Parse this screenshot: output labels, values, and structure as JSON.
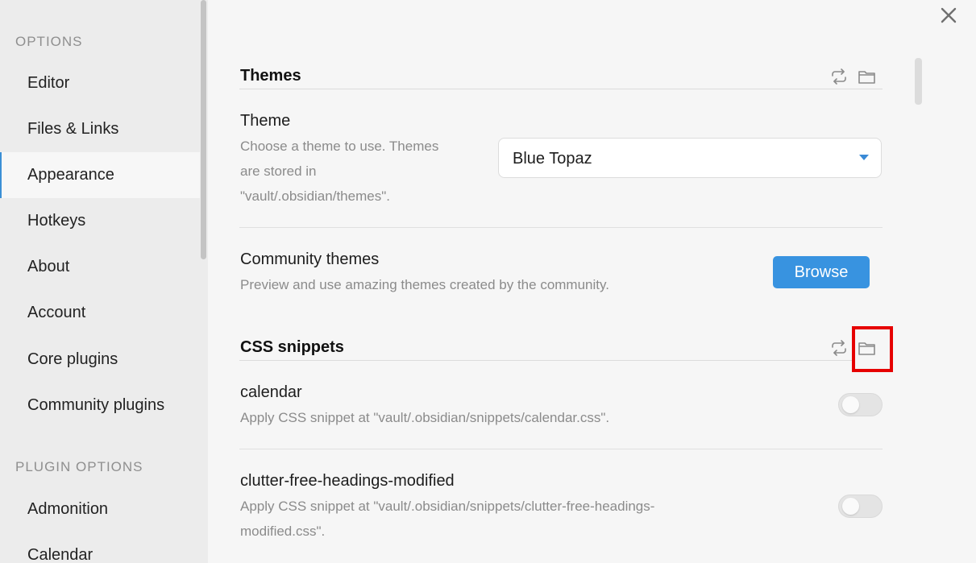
{
  "sidebar": {
    "section_options": "OPTIONS",
    "items": [
      {
        "label": "Editor"
      },
      {
        "label": "Files & Links"
      },
      {
        "label": "Appearance"
      },
      {
        "label": "Hotkeys"
      },
      {
        "label": "About"
      },
      {
        "label": "Account"
      },
      {
        "label": "Core plugins"
      },
      {
        "label": "Community plugins"
      }
    ],
    "section_plugin_options": "PLUGIN OPTIONS",
    "plugin_items": [
      {
        "label": "Admonition"
      },
      {
        "label": "Calendar"
      }
    ],
    "active_item": "Appearance"
  },
  "window": {
    "close_icon": "close-icon"
  },
  "themes": {
    "title": "Themes",
    "theme_name": "Theme",
    "theme_desc": "Choose a theme to use. Themes are stored in \"vault/.obsidian/themes\".",
    "theme_desc_lines": [
      "Choose a theme to use. Themes",
      "are stored in",
      "\"vault/.obsidian/themes\"."
    ],
    "theme_selected": "Blue Topaz",
    "community_name": "Community themes",
    "community_desc": "Preview and use amazing themes created by the community.",
    "browse_label": "Browse"
  },
  "snippets": {
    "title": "CSS snippets",
    "items": [
      {
        "name": "calendar",
        "desc_lines": [
          "Apply CSS snippet at \"vault/.obsidian/snippets/calendar.css\"."
        ],
        "enabled": false
      },
      {
        "name": "clutter-free-headings-modified",
        "desc_lines": [
          "Apply CSS snippet at \"vault/.obsidian/snippets/clutter-free-headings-",
          "modified.css\"."
        ],
        "enabled": false
      }
    ]
  },
  "colors": {
    "accent": "#3893e0",
    "highlight": "#e60000"
  }
}
